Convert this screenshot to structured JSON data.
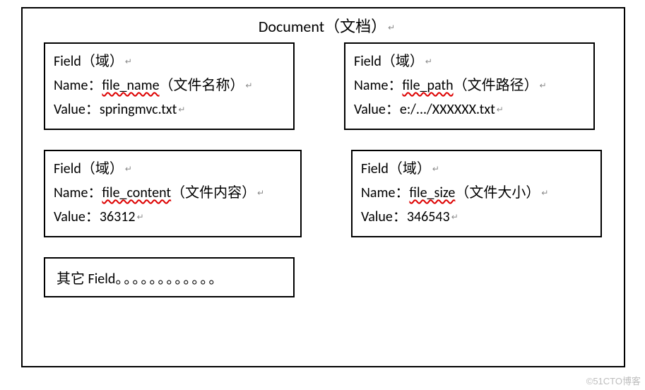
{
  "title": "Document（文档）",
  "labels": {
    "field_header": "Field（域）",
    "name_prefix": "Name：",
    "value_prefix": "Value："
  },
  "fields": [
    {
      "name_token": "file_name",
      "name_desc": "（文件名称）",
      "value": "springmvc.txt"
    },
    {
      "name_token": "file_path",
      "name_desc": "（文件路径）",
      "value": "e:/.../XXXXXX.txt"
    },
    {
      "name_token": "file_content",
      "name_desc": "（文件内容）",
      "value": "36312"
    },
    {
      "name_token": "file_size",
      "name_desc": "（文件大小）",
      "value": "346543"
    }
  ],
  "other_text": "其它 Field",
  "return_glyph": "↵",
  "watermark": "©51CTO博客"
}
